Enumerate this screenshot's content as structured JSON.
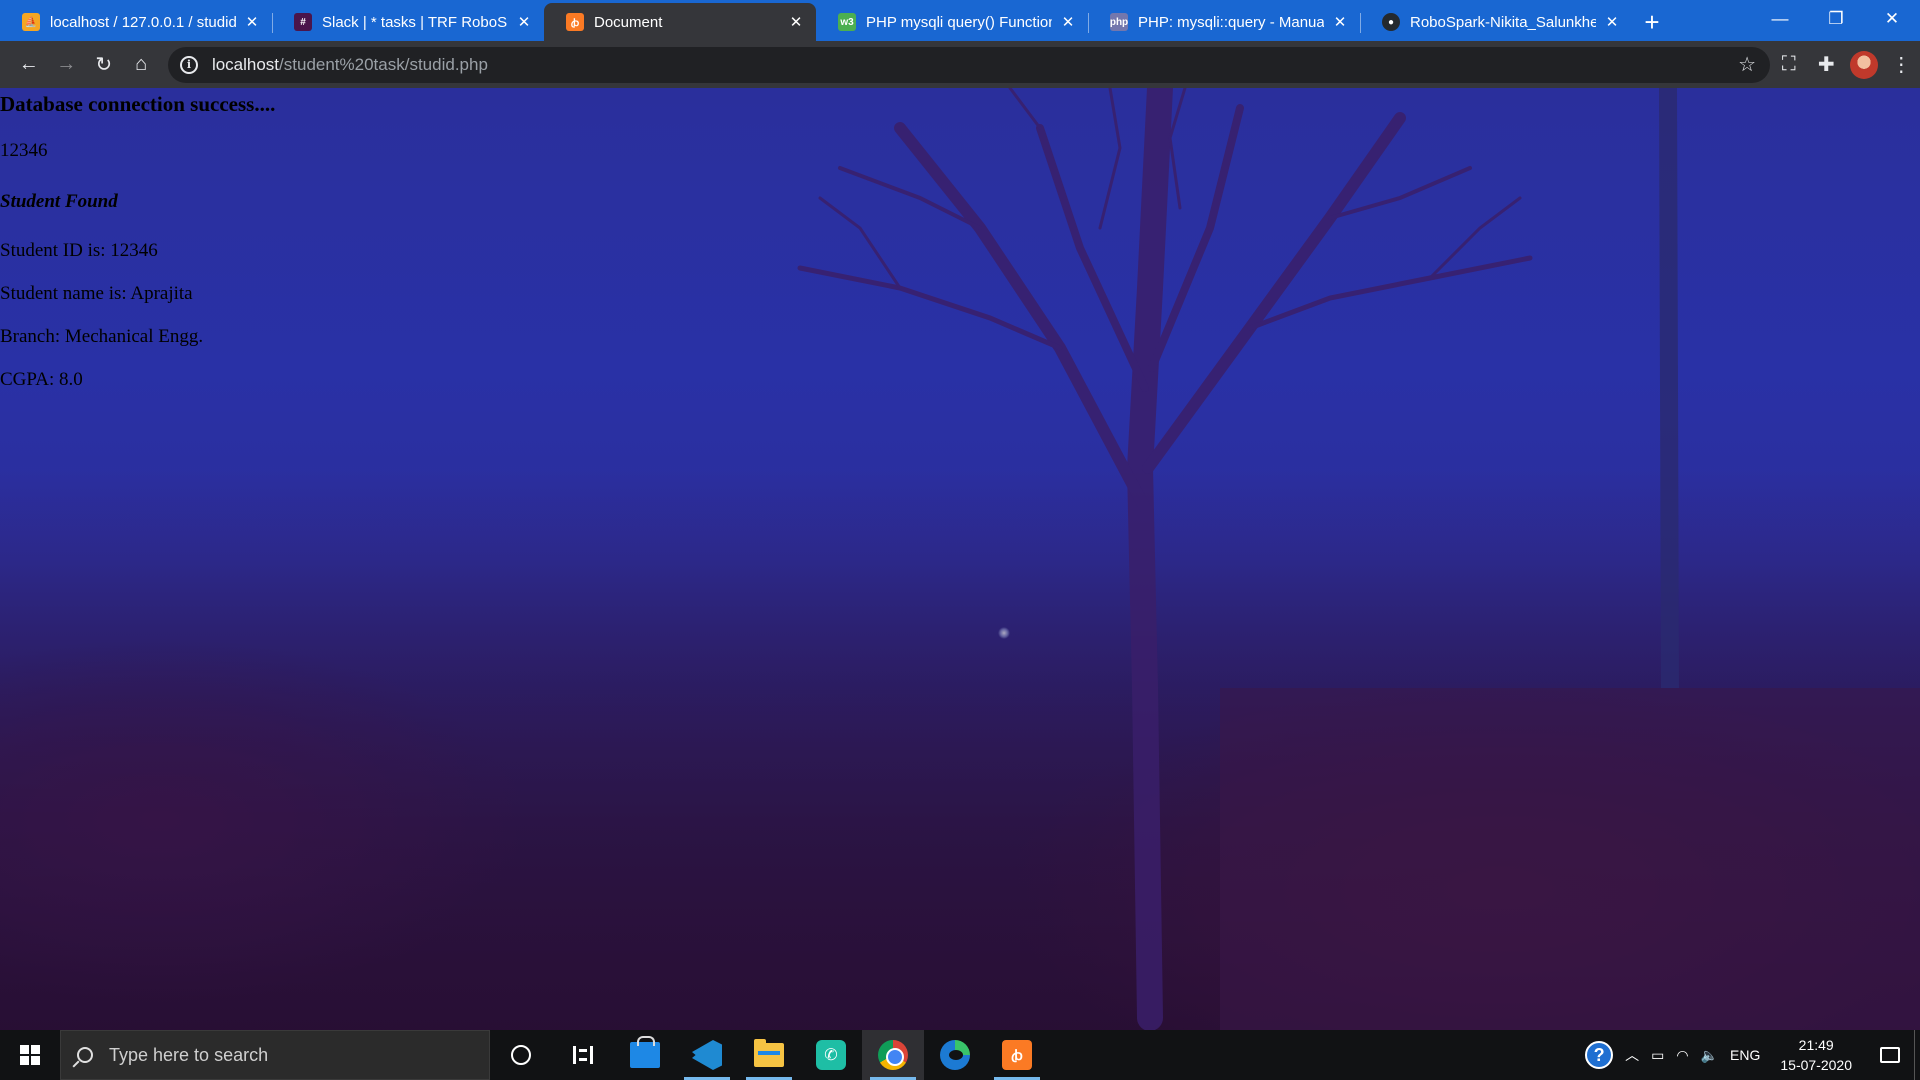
{
  "browser": {
    "tabs": [
      {
        "title": "localhost / 127.0.0.1 / studid",
        "favicon": "phpmyadmin-icon",
        "color": "#f5a623",
        "active": false
      },
      {
        "title": "Slack | * tasks | TRF RoboSpark",
        "favicon": "slack-icon",
        "color": "#4a154b",
        "active": false
      },
      {
        "title": "Document",
        "favicon": "xampp-icon",
        "color": "#fb7a24",
        "active": true
      },
      {
        "title": "PHP mysqli query() Function",
        "favicon": "w3schools-icon",
        "color": "#4caf50",
        "active": false
      },
      {
        "title": "PHP: mysqli::query - Manual",
        "favicon": "php-icon",
        "color": "#7377ad",
        "active": false
      },
      {
        "title": "RoboSpark-Nikita_Salunkhe/",
        "favicon": "github-icon",
        "color": "#24292e",
        "active": false
      }
    ],
    "new_tab": "+",
    "window_controls": {
      "minimize": "—",
      "restore": "❐",
      "close": "✕"
    },
    "url": {
      "host": "localhost",
      "path": "/student%20task/studid.php"
    }
  },
  "page": {
    "heading": "Database connection success....",
    "id_echo": "12346",
    "status": "Student Found",
    "student_id": "Student ID is: 12346",
    "student_name": "Student name is: Aprajita",
    "branch": "Branch: Mechanical Engg.",
    "cgpa": "CGPA: 8.0"
  },
  "taskbar": {
    "search_placeholder": "Type here to search",
    "apps": [
      "cortana",
      "task-view",
      "microsoft-store",
      "vscode",
      "file-explorer",
      "whatsapp",
      "chrome",
      "edge",
      "xampp"
    ],
    "tray": {
      "language": "ENG",
      "time": "21:49",
      "date": "15-07-2020"
    }
  },
  "colors": {
    "tab_strip": "#1967d2",
    "toolbar": "#35363a",
    "taskbar": "#111214"
  }
}
